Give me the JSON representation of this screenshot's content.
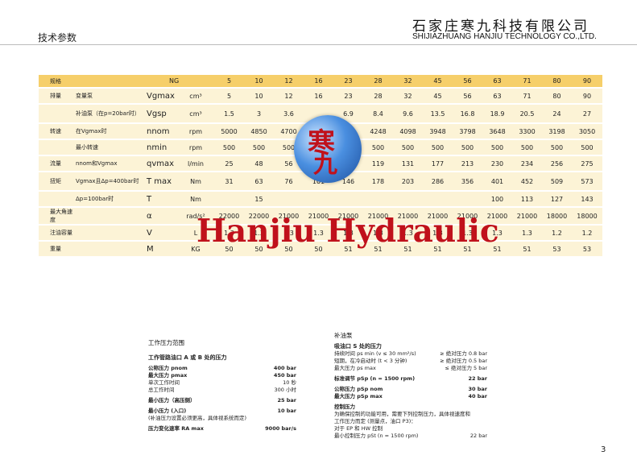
{
  "header": {
    "section_title": "技术参数",
    "company_cn": "石家庄寒九科技有限公司",
    "company_en": "SHIJIAZHUANG HANJIU TECHNOLOGY CO.,LTD."
  },
  "spec_table": {
    "head": [
      "规格",
      "NG",
      "5",
      "10",
      "12",
      "16",
      "23",
      "28",
      "32",
      "45",
      "56",
      "63",
      "71",
      "80",
      "90"
    ],
    "rows": [
      {
        "group": "排量",
        "desc": "变量泵",
        "sym": "Vgmax",
        "unit": "cm³",
        "vals": [
          "5",
          "10",
          "12",
          "16",
          "23",
          "28",
          "32",
          "45",
          "56",
          "63",
          "71",
          "80",
          "90"
        ]
      },
      {
        "group": "",
        "desc": "补油泵（在p=20bar时）",
        "sym": "Vgsp",
        "unit": "cm³",
        "vals": [
          "1.5",
          "3",
          "3.6",
          "",
          "6.9",
          "8.4",
          "9.6",
          "13.5",
          "16.8",
          "18.9",
          "20.5",
          "24",
          "27"
        ]
      },
      {
        "group": "转速",
        "desc": "在Vgmax时",
        "sym": "nnom",
        "unit": "rpm",
        "vals": [
          "5000",
          "4850",
          "4700",
          "",
          "",
          "4248",
          "4098",
          "3948",
          "3798",
          "3648",
          "3300",
          "3198",
          "3050"
        ]
      },
      {
        "group": "",
        "desc": "最小转速",
        "sym": "nmin",
        "unit": "rpm",
        "vals": [
          "500",
          "500",
          "500",
          "",
          "",
          "500",
          "500",
          "500",
          "500",
          "500",
          "500",
          "500",
          "500"
        ]
      },
      {
        "group": "流量",
        "desc": "nnom和Vgmax",
        "sym": "qvmax",
        "unit": "l/min",
        "vals": [
          "25",
          "48",
          "56",
          "",
          "",
          "119",
          "131",
          "177",
          "213",
          "230",
          "234",
          "256",
          "275"
        ]
      },
      {
        "group": "扭矩",
        "desc": "Vgmax且Δp=400bar时",
        "sym": "T max",
        "unit": "Nm",
        "vals": [
          "31",
          "63",
          "76",
          "101",
          "146",
          "178",
          "203",
          "286",
          "356",
          "401",
          "452",
          "509",
          "573"
        ]
      },
      {
        "group": "",
        "desc": "Δp=100bar时",
        "sym": "T",
        "unit": "Nm",
        "vals": [
          "",
          "15",
          "",
          "",
          "",
          "",
          "",
          "",
          "",
          "100",
          "113",
          "127",
          "143"
        ]
      },
      {
        "group": "最大角速度",
        "desc": "",
        "sym": "α",
        "unit": "rad/s²",
        "vals": [
          "22000",
          "22000",
          "21000",
          "21000",
          "21000",
          "21000",
          "21000",
          "21000",
          "21000",
          "21000",
          "21000",
          "18000",
          "18000"
        ]
      },
      {
        "group": "注油容量",
        "desc": "",
        "sym": "V",
        "unit": "L",
        "vals": [
          "1.3",
          "1.3",
          "1.3",
          "1.3",
          "1.3",
          "1.3",
          "1.3",
          "1.3",
          "1.3",
          "1.3",
          "1.3",
          "1.2",
          "1.2"
        ]
      },
      {
        "group": "重量",
        "desc": "",
        "sym": "M",
        "unit": "KG",
        "vals": [
          "50",
          "50",
          "50",
          "50",
          "51",
          "51",
          "51",
          "51",
          "51",
          "51",
          "51",
          "53",
          "53"
        ]
      }
    ]
  },
  "logo": {
    "char1": "寒",
    "char2": "九"
  },
  "watermark": "Hanjiu Hydraulic",
  "working_pressure": {
    "title": "工作压力范围",
    "subtitle": "工作管路油口 A 或 B 处的压力",
    "lines": [
      {
        "label": "公称压力 pnom",
        "value": "400 bar",
        "bold": true
      },
      {
        "label": "最大压力 pmax",
        "value": "450 bar",
        "bold": true
      },
      {
        "label": "单次工作时间",
        "value": "10 秒",
        "bold": false
      },
      {
        "label": "总工作时间",
        "value": "300 小时",
        "bold": false
      },
      {
        "label": "最小压力（高压侧）",
        "value": "25 bar",
        "bold": true
      },
      {
        "label": "最小压力 (入口)",
        "value": "10 bar",
        "bold": true
      },
      {
        "label": "(补油压力设置必须更高，具体视系统而定)",
        "value": "",
        "bold": false
      },
      {
        "label": "压力变化速率 RA max",
        "value": "9000 bar/s",
        "bold": true
      }
    ]
  },
  "charge_pump": {
    "title": "补油泵",
    "subtitle": "吸油口 S 处的压力",
    "lines": [
      {
        "label": "持续时间 ps min (v ≤ 30 mm²/s)",
        "value": "≥ 绝对压力 0.8 bar",
        "bold": false
      },
      {
        "label": "短期，在冷启动时 (t < 3 分钟)",
        "value": "≥ 绝对压力 0.5 bar",
        "bold": false
      },
      {
        "label": "最大压力 ps max",
        "value": "≤ 绝对压力 5 bar",
        "bold": false
      },
      {
        "label": "标准调节 pSp (n = 1500 rpm)",
        "value": "22 bar",
        "bold": true
      },
      {
        "label": "公称压力 pSp nom",
        "value": "30 bar",
        "bold": true
      },
      {
        "label": "最大压力 pSp max",
        "value": "40 bar",
        "bold": true
      },
      {
        "label": "控制压力",
        "value": "",
        "bold": true
      },
      {
        "label": "为确保控制的功能可用，需要下列控制压力，具体视速度和",
        "value": "",
        "bold": false
      },
      {
        "label": "工作压力而定 (测量点，油口 P3)：",
        "value": "",
        "bold": false
      },
      {
        "label": "对于 EP 和 HW 控制",
        "value": "",
        "bold": false
      },
      {
        "label": "最小控制压力 pSt (n = 1500 rpm)",
        "value": "22 bar",
        "bold": false
      }
    ]
  },
  "page_number": "3"
}
